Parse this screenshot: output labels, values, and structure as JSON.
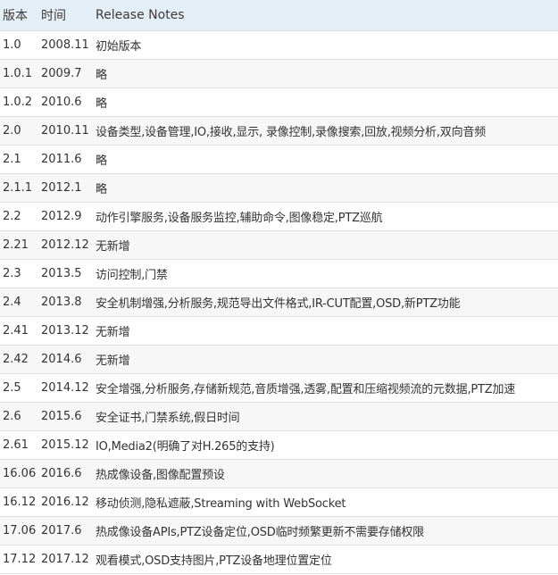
{
  "table": {
    "headers": {
      "version": "版本",
      "date": "时间",
      "notes": "Release Notes"
    },
    "rows": [
      {
        "version": "1.0",
        "date": "2008.11",
        "notes": "初始版本"
      },
      {
        "version": "1.0.1",
        "date": "2009.7",
        "notes": "略"
      },
      {
        "version": "1.0.2",
        "date": "2010.6",
        "notes": "略"
      },
      {
        "version": "2.0",
        "date": "2010.11",
        "notes": "设备类型,设备管理,IO,接收,显示, 录像控制,录像搜索,回放,视频分析,双向音频"
      },
      {
        "version": "2.1",
        "date": "2011.6",
        "notes": "略"
      },
      {
        "version": "2.1.1",
        "date": "2012.1",
        "notes": "略"
      },
      {
        "version": "2.2",
        "date": "2012.9",
        "notes": "动作引擎服务,设备服务监控,辅助命令,图像稳定,PTZ巡航"
      },
      {
        "version": "2.21",
        "date": "2012.12",
        "notes": "无新增"
      },
      {
        "version": "2.3",
        "date": "2013.5",
        "notes": "访问控制,门禁"
      },
      {
        "version": "2.4",
        "date": "2013.8",
        "notes": "安全机制增强,分析服务,规范导出文件格式,IR-CUT配置,OSD,新PTZ功能"
      },
      {
        "version": "2.41",
        "date": "2013.12",
        "notes": "无新增"
      },
      {
        "version": "2.42",
        "date": "2014.6",
        "notes": "无新增"
      },
      {
        "version": "2.5",
        "date": "2014.12",
        "notes": "安全增强,分析服务,存储新规范,音质增强,透雾,配置和压缩视频流的元数据,PTZ加速"
      },
      {
        "version": "2.6",
        "date": "2015.6",
        "notes": "安全证书,门禁系统,假日时间"
      },
      {
        "version": "2.61",
        "date": "2015.12",
        "notes": "IO,Media2(明确了对H.265的支持)"
      },
      {
        "version": "16.06",
        "date": "2016.6",
        "notes": "热成像设备,图像配置预设"
      },
      {
        "version": "16.12",
        "date": "2016.12",
        "notes": "移动侦测,隐私遮蔽,Streaming with WebSocket"
      },
      {
        "version": "17.06",
        "date": "2017.6",
        "notes": "热成像设备APIs,PTZ设备定位,OSD临时频繁更新不需要存储权限"
      },
      {
        "version": "17.12",
        "date": "2017.12",
        "notes": "观看模式,OSD支持图片,PTZ设备地理位置定位"
      }
    ]
  }
}
